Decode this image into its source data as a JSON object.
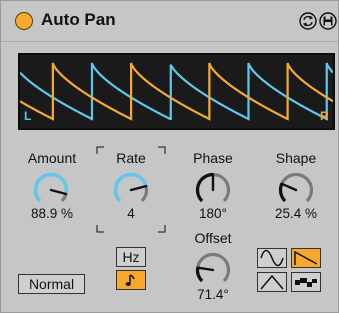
{
  "device": {
    "title": "Auto Pan",
    "power_on": true,
    "accent_color": "#f8a92d",
    "left_color": "#5ec8ef"
  },
  "display": {
    "left_label": "L",
    "right_label": "R"
  },
  "controls": {
    "amount": {
      "label": "Amount",
      "value": "88.9 %",
      "fraction": 0.889
    },
    "rate": {
      "label": "Rate",
      "value": "4",
      "fraction": 0.78
    },
    "phase": {
      "label": "Phase",
      "value": "180°",
      "fraction": 0.5
    },
    "shape": {
      "label": "Shape",
      "value": "25.4 %",
      "fraction": 0.254
    },
    "offset": {
      "label": "Offset",
      "value": "71.4°",
      "fraction": 0.198
    }
  },
  "buttons": {
    "mode": "Normal",
    "hz": "Hz",
    "sync_icon": "note-icon"
  },
  "waveforms": {
    "selected": "sawtooth-down",
    "options": [
      "sine-icon",
      "sawtooth-down-icon",
      "triangle-icon",
      "random-icon"
    ]
  }
}
